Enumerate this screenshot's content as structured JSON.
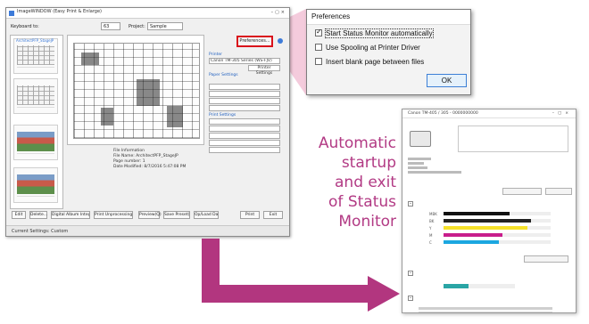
{
  "app_window": {
    "title": "ImageWINDOW (Easy Print & Enlarge)",
    "keyboard_label": "Keyboard to:",
    "zoom_value": "63",
    "project_label": "Project:",
    "project_value": "Sample",
    "preferences_button": "Preferences...",
    "thumbnail_name": "ArchitectPFP_StageJP",
    "info": {
      "header": "File Information",
      "file_name_label": "File Name:",
      "file_name_value": "ArchitectPFP_StageJP",
      "page_number_label": "Page number:",
      "page_number_value": "1",
      "date_label": "Date Modified:",
      "date_value": "8/7/2016 5:47:08 PM"
    },
    "settings": {
      "printer_header": "Printer",
      "printer_value": "Canon TM-305 Series (WS-FJV)",
      "printer_button": "Printer Settings",
      "paper_header": "Paper Settings",
      "general_header": "Print Settings"
    },
    "bottom_buttons": [
      "Edit",
      "Delete...",
      "Digital Album Integration...",
      "Print Unprocessing Manager...",
      "Preview(Q)",
      "Save Preset(S)",
      "Op/Load Data",
      "Print",
      "Exit"
    ],
    "status_text": "Current Settings: Custom"
  },
  "preferences_dialog": {
    "title": "Preferences",
    "options": [
      {
        "label": "Start Status Monitor automatically",
        "checked": true
      },
      {
        "label": "Use Spooling at Printer Driver",
        "checked": false
      },
      {
        "label": "Insert blank page between files",
        "checked": false
      }
    ],
    "ok_label": "OK"
  },
  "caption": {
    "lines": [
      "Automatic",
      "startup",
      "and exit",
      "of Status",
      "Monitor"
    ],
    "color": "#b23a84"
  },
  "status_monitor": {
    "title": "Canon TM-405 / 305 - 0000000000",
    "ink_levels": [
      {
        "name": "MBK",
        "color": "#111111",
        "level": 0.62
      },
      {
        "name": "BK",
        "color": "#222222",
        "level": 0.82
      },
      {
        "name": "Y",
        "color": "#f5e12a",
        "level": 0.78
      },
      {
        "name": "M",
        "color": "#c81d8c",
        "level": 0.55
      },
      {
        "name": "C",
        "color": "#1ba7e0",
        "level": 0.52
      }
    ],
    "maintenance_level": 0.35
  },
  "colors": {
    "highlight_red": "#d9121b",
    "connector_pink": "#f2c2d6",
    "arrow_purple": "#b2367f"
  }
}
